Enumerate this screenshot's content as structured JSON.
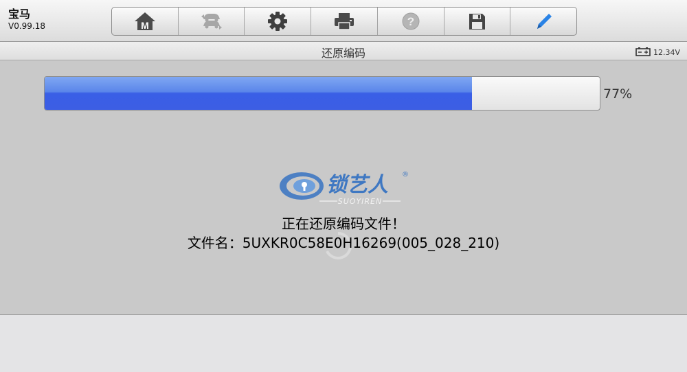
{
  "app": {
    "name": "宝马",
    "version": "V0.99.18"
  },
  "toolbar": {
    "items": [
      {
        "icon": "home-icon"
      },
      {
        "icon": "vehicle-swap-icon"
      },
      {
        "icon": "gear-icon"
      },
      {
        "icon": "printer-icon"
      },
      {
        "icon": "help-icon"
      },
      {
        "icon": "save-icon"
      },
      {
        "icon": "pen-icon"
      }
    ]
  },
  "title_bar": {
    "title": "还原编码",
    "battery_voltage": "12.34V"
  },
  "progress": {
    "percent_label": "77%",
    "value": 0.77
  },
  "logo": {
    "brand_text": "锁艺人",
    "sub_text": "SUOYIREN",
    "registered_mark": "®"
  },
  "status": {
    "message": "正在还原编码文件！",
    "file_line": "文件名：5UXKR0C58E0H16269(005_028_210)"
  },
  "colors": {
    "progress_fill": "#3c5ee4",
    "logo_blue": "#3f78c2",
    "pen_blue": "#2a83e6"
  }
}
